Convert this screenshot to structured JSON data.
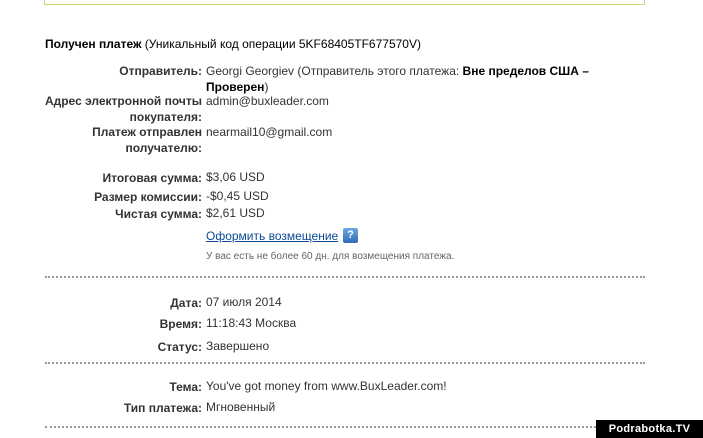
{
  "heading": {
    "bold": "Получен платеж",
    "rest": " (Уникальный код операции 5KF68405TF677570V)"
  },
  "details": {
    "sender_label": "Отправитель:",
    "sender_value": "Georgi Georgiev (Отправитель этого платежа: ",
    "sender_status": "Вне пределов США – Проверен",
    "sender_close": ")",
    "buyer_email_label": "Адрес электронной почты покупателя:",
    "buyer_email_value": "admin@buxleader.com",
    "recipient_label": "Платеж отправлен получателю:",
    "recipient_value": "nearmail10@gmail.com"
  },
  "amounts": {
    "total_label": "Итоговая сумма:",
    "total_value": "$3,06 USD",
    "fee_label": "Размер комиссии:",
    "fee_value": "-$0,45 USD",
    "net_label": "Чистая сумма:",
    "net_value": "$2,61 USD",
    "refund_link": "Оформить возмещение",
    "help_icon": "?",
    "refund_note": "У вас есть не более 60 дн. для возмещения платежа."
  },
  "timing": {
    "date_label": "Дата:",
    "date_value": "07 июля 2014",
    "time_label": "Время:",
    "time_value": "11:18:43 Москва",
    "status_label": "Статус:",
    "status_value": "Завершено"
  },
  "subject": {
    "subject_label": "Тема:",
    "subject_value": "You've got money from www.BuxLeader.com!",
    "type_label": "Тип платежа:",
    "type_value": "Мгновенный"
  },
  "watermark": "Podrabotka.TV",
  "colors": {
    "link": "#0b4a94",
    "top_box_border": "#c9d67a"
  }
}
